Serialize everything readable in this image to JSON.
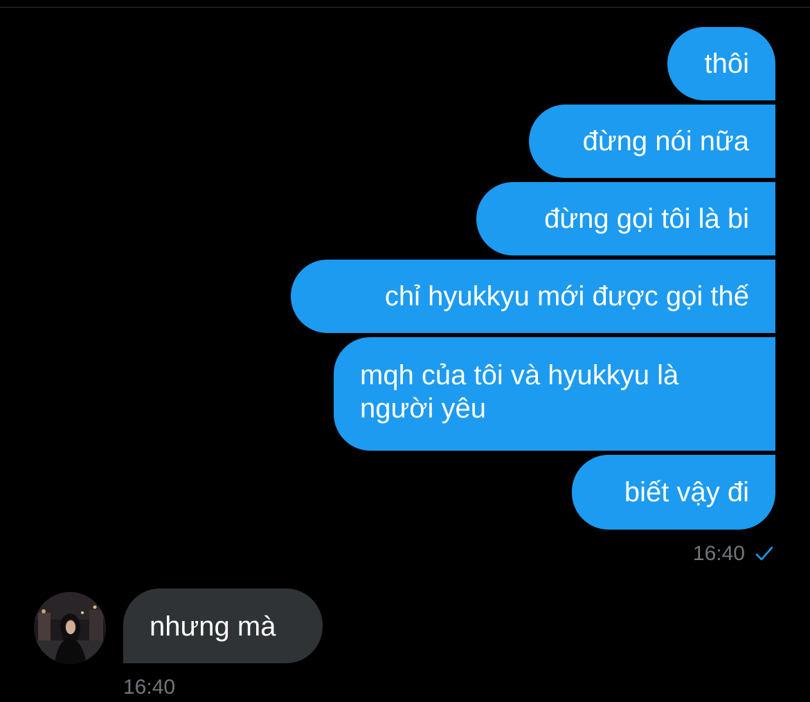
{
  "conversation": {
    "outgoing": [
      {
        "text": "thôi"
      },
      {
        "text": "đừng nói nữa"
      },
      {
        "text": "đừng gọi tôi là bi"
      },
      {
        "text": "chỉ hyukkyu mới được gọi thế"
      },
      {
        "text": "mqh của tôi và hyukkyu là người yêu"
      },
      {
        "text": "biết vậy đi"
      }
    ],
    "outgoing_time": "16:40",
    "outgoing_status_icon": "check-icon",
    "incoming": [
      {
        "text": "nhưng mà"
      }
    ],
    "incoming_time": "16:40",
    "incoming_avatar_icon": "avatar-photo"
  },
  "colors": {
    "background": "#000000",
    "outgoing_bubble": "#1d9bf0",
    "incoming_bubble": "#2f3336",
    "timestamp": "#71767b",
    "check": "#1d9bf0"
  }
}
